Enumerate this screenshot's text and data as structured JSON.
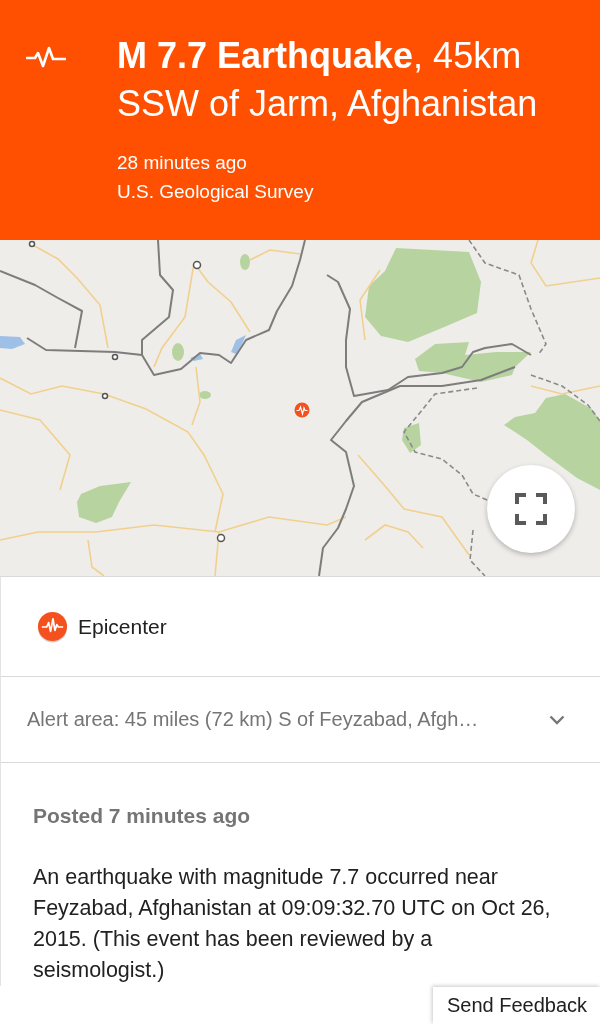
{
  "header": {
    "title": "**M 7.7 Earthquake**, 45km SSW of Jarm, Afghanistan",
    "time": "28 minutes ago",
    "source": "U.S. Geological Survey"
  },
  "epicenter": {
    "label": "Epicenter"
  },
  "alert_area": {
    "text": "Alert area: 45 miles (72 km) S of Feyzabad, Afgh…",
    "expanded": false
  },
  "post": {
    "posted": "Posted 7 minutes ago",
    "body": "An earthquake with magnitude 7.7 occurred near Feyzabad, Afghanistan at 09:09:32.70 UTC on Oct 26, 2015. (This event has been reviewed by a seismologist.)"
  },
  "feedback": {
    "label": "Send Feedback"
  }
}
